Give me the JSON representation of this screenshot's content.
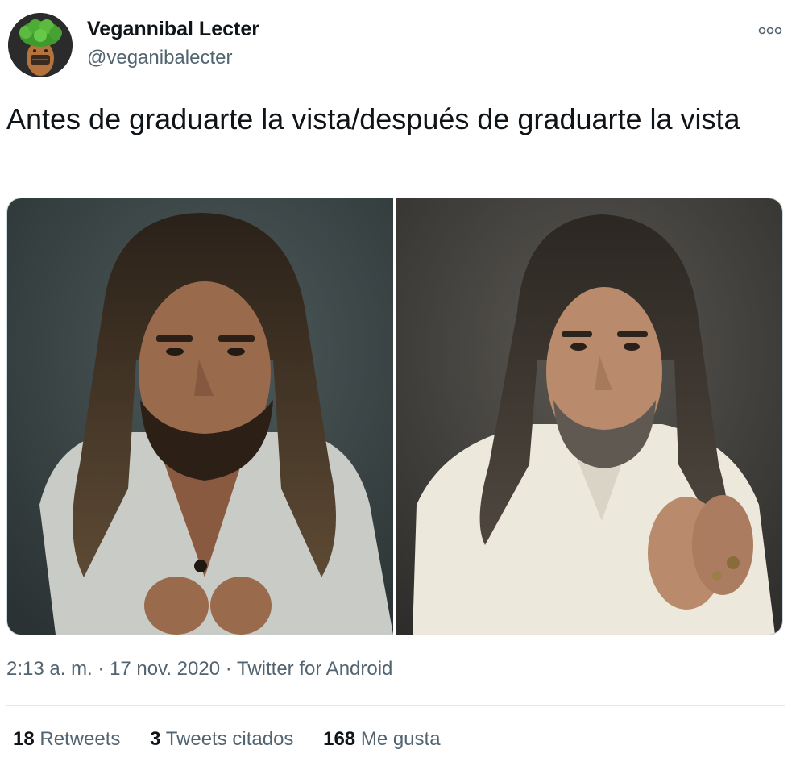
{
  "author": {
    "display_name": "Vegannibal Lecter",
    "handle": "@veganibalecter",
    "avatar_icon": "profile-avatar"
  },
  "more_icon": "more-options-icon",
  "tweet": {
    "text": "Antes de graduarte la vista/después de graduarte la vista"
  },
  "media": [
    {
      "name": "photo-before",
      "icon": "photo-long-haired-bearded-man-grey-shirt"
    },
    {
      "name": "photo-after",
      "icon": "photo-long-haired-bearded-man-white-jacket"
    }
  ],
  "meta": {
    "time": "2:13 a. m.",
    "sep1": " · ",
    "date": "17 nov. 2020",
    "sep2": " · ",
    "source": "Twitter for Android"
  },
  "stats": {
    "retweets_count": "18",
    "retweets_label": "Retweets",
    "quotes_count": "3",
    "quotes_label": "Tweets citados",
    "likes_count": "168",
    "likes_label": "Me gusta"
  },
  "colors": {
    "text_primary": "#0f1419",
    "text_secondary": "#536471",
    "border": "#cfd9de"
  }
}
